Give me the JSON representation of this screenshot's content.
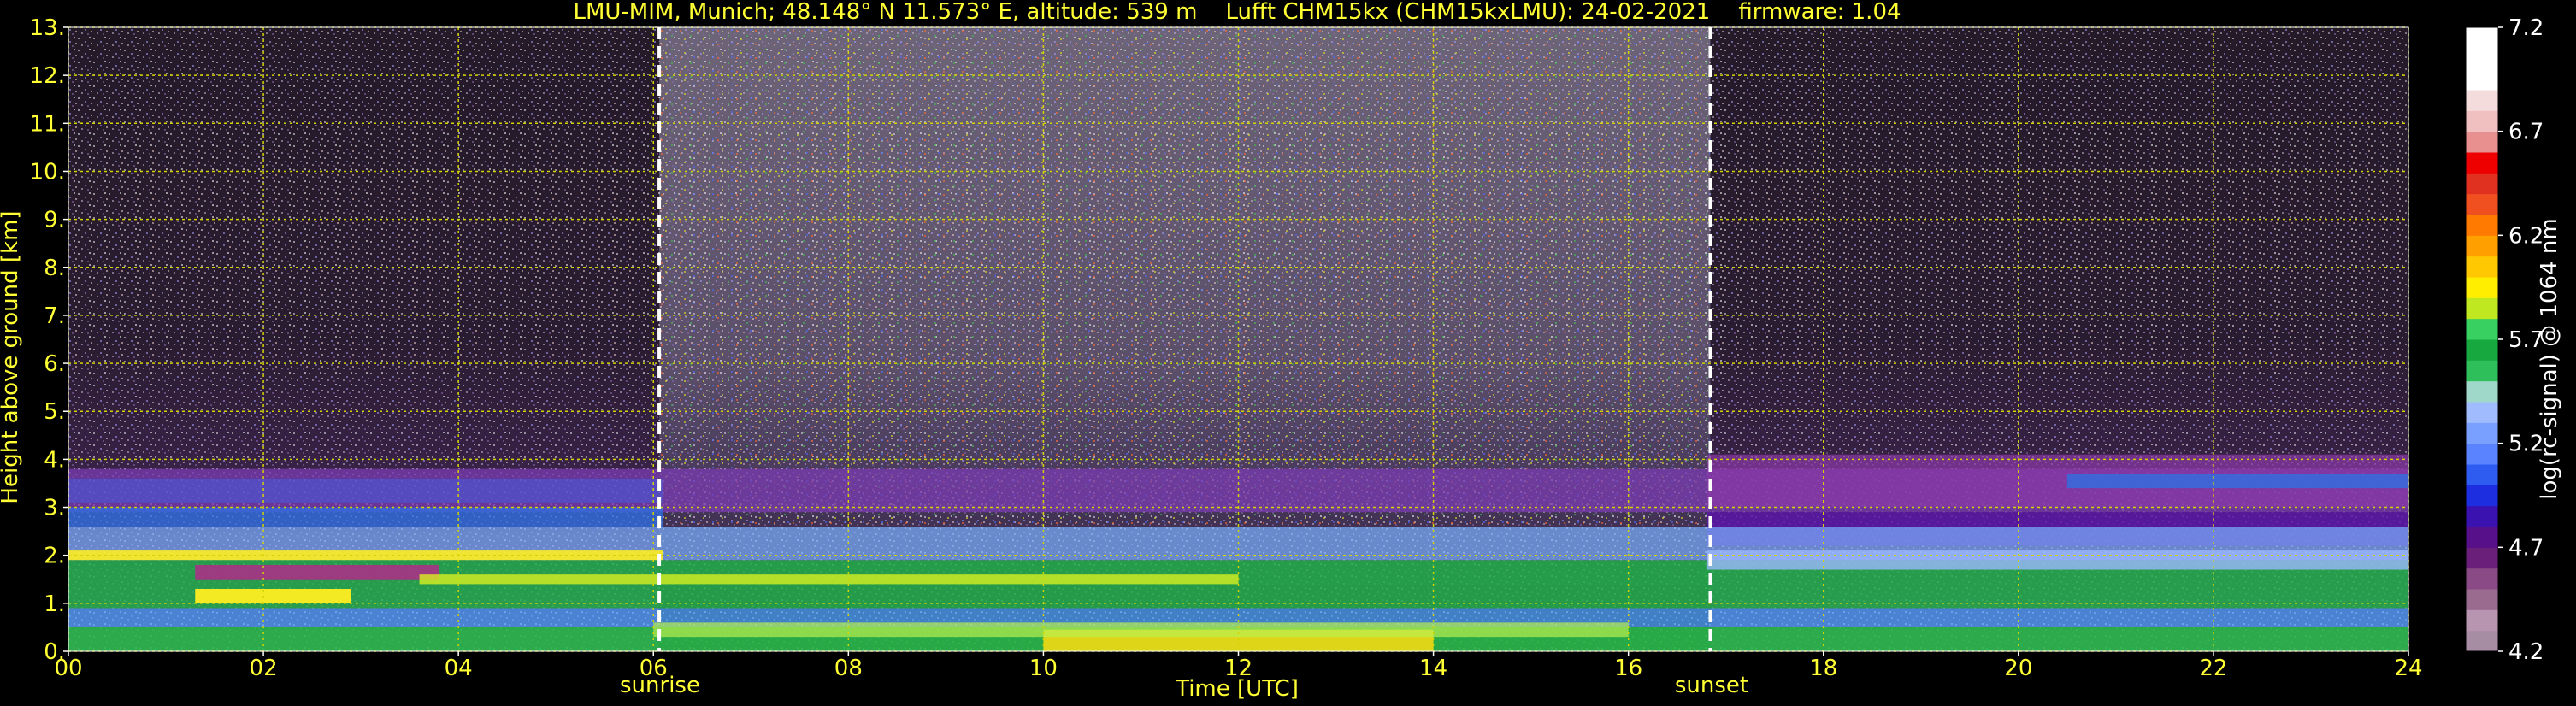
{
  "chart_data": {
    "type": "heatmap",
    "title": "LMU-MIM, Munich; 48.148° N 11.573° E, altitude: 539 m    Lufft CHM15kx (CHM15kxLMU): 24-02-2021    firmware: 1.04",
    "xlabel": "Time [UTC]",
    "ylabel": "Height above ground [km]",
    "xlim": [
      0,
      24
    ],
    "ylim": [
      0,
      13
    ],
    "x_ticks": [
      0,
      2,
      4,
      6,
      8,
      10,
      12,
      14,
      16,
      18,
      20,
      22,
      24
    ],
    "x_tick_labels": [
      "00",
      "02",
      "04",
      "06",
      "08",
      "10",
      "12",
      "14",
      "16",
      "18",
      "20",
      "22",
      "24"
    ],
    "y_ticks": [
      0,
      1,
      2,
      3,
      4,
      5,
      6,
      7,
      8,
      9,
      10,
      11,
      12,
      13
    ],
    "y_tick_labels": [
      "0.",
      "1.",
      "2.",
      "3.",
      "4.",
      "5.",
      "6.",
      "7.",
      "8.",
      "9.",
      "10.",
      "11.",
      "12.",
      "13."
    ],
    "grid": true,
    "annotations": [
      {
        "x": 6.06,
        "label": "sunrise"
      },
      {
        "x": 16.84,
        "label": "sunset"
      }
    ],
    "colorbar": {
      "label": "log(rc-signal) @ 1064 nm",
      "min": 4.2,
      "max": 7.2,
      "ticks": [
        4.2,
        4.7,
        5.2,
        5.7,
        6.2,
        6.7,
        7.2
      ]
    }
  },
  "colors": {
    "background": "#000000",
    "text": "#ffff33",
    "grid": "#d4d400",
    "marker_line": "#ffffff",
    "colorbar_text": "#ffffff"
  }
}
